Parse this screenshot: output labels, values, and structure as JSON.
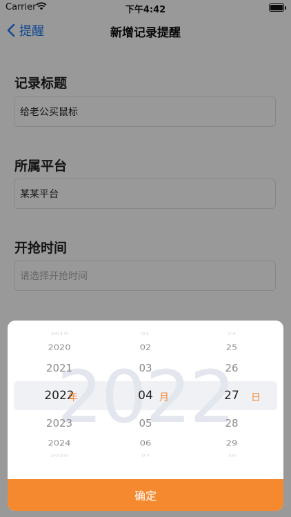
{
  "status_bar": {
    "carrier": "Carrier",
    "time": "下午4:42"
  },
  "nav": {
    "back_label": "提醒",
    "title": "新增记录提醒"
  },
  "form": {
    "title_label": "记录标题",
    "title_value": "给老公买鼠标",
    "platform_label": "所属平台",
    "platform_value": "某某平台",
    "time_label": "开抢时间",
    "time_placeholder": "请选择开抢时间"
  },
  "picker": {
    "watermark": "2022",
    "years": [
      "2019",
      "2020",
      "2021",
      "2022",
      "2023",
      "2024",
      "2025"
    ],
    "months": [
      "01",
      "02",
      "03",
      "04",
      "05",
      "06",
      "07"
    ],
    "days": [
      "24",
      "25",
      "26",
      "27",
      "28",
      "29",
      "30"
    ],
    "year_unit": "年",
    "month_unit": "月",
    "day_unit": "日",
    "confirm_label": "确定",
    "accent_color": "#f4892f"
  }
}
